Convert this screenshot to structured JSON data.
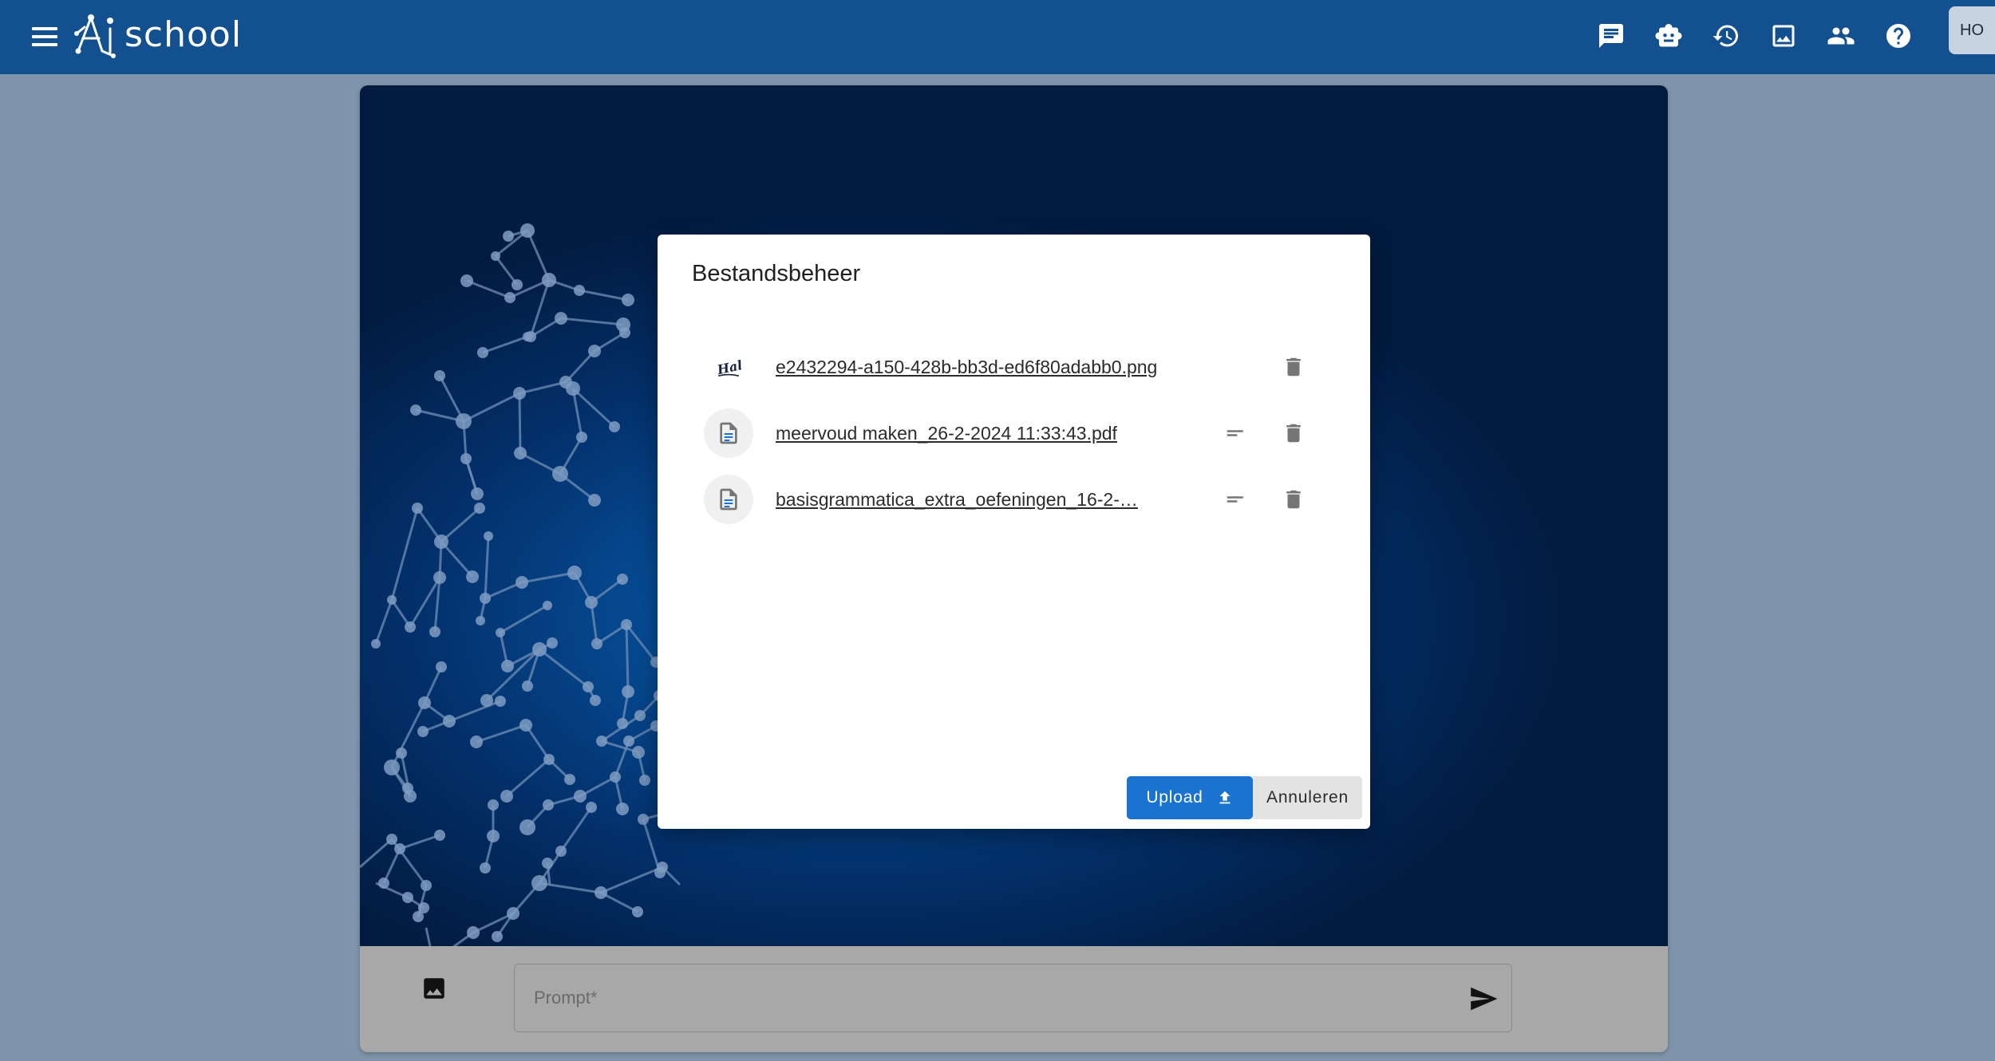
{
  "header": {
    "menu_icon": "hamburger-menu-icon",
    "logo_text": "school",
    "logo_mark": "Ai",
    "nav_icons": [
      "chat-icon",
      "robot-icon",
      "history-icon",
      "gallery-icon",
      "people-icon",
      "help-icon"
    ],
    "avatar_initials": "HO",
    "bg_color": "#12508f"
  },
  "dialog": {
    "title": "Bestandsbeheer",
    "files": [
      {
        "name": "e2432294-a150-428b-bb3d-ed6f80adabb0.png",
        "thumb": "image-thumbnail",
        "has_details": false
      },
      {
        "name": "meervoud maken_26-2-2024 11:33:43.pdf",
        "thumb": "document-icon",
        "has_details": true
      },
      {
        "name": "basisgrammatica_extra_oefeningen_16-2-…",
        "thumb": "document-icon",
        "has_details": true
      }
    ],
    "upload_label": "Upload",
    "cancel_label": "Annuleren",
    "accent_color": "#1a73d1"
  },
  "composer": {
    "prompt_placeholder": "Prompt*",
    "image_icon": "image-icon",
    "send_icon": "send-icon"
  }
}
